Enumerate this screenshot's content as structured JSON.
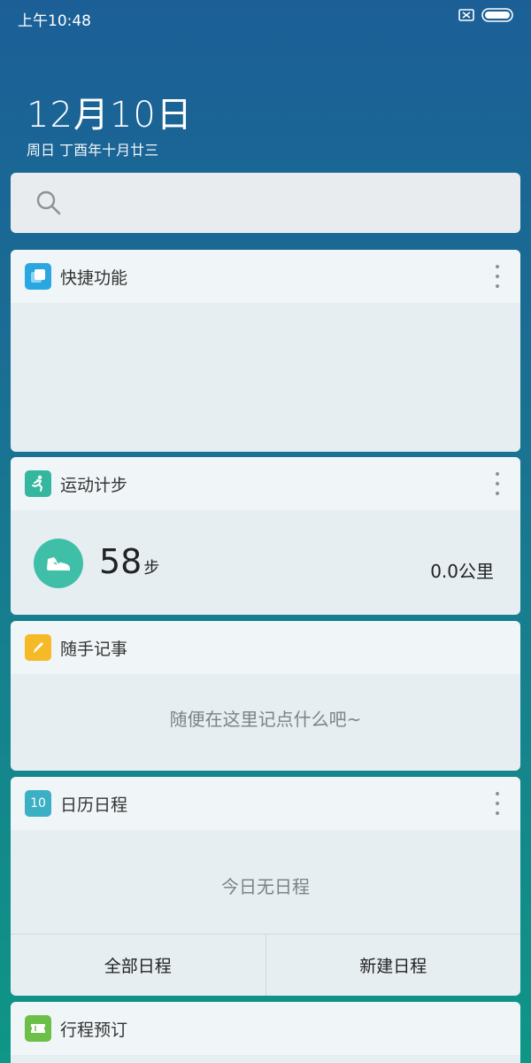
{
  "status_bar": {
    "time": "上午10:48",
    "icons": [
      "no-sim-icon",
      "battery-icon"
    ]
  },
  "header": {
    "date": "12月10日",
    "subtitle": "周日 丁酉年十月廿三"
  },
  "search": {
    "placeholder": ""
  },
  "cards": {
    "quick_functions": {
      "title": "快捷功能",
      "icon": "quick-functions-icon",
      "icon_color": "#2aa7e0"
    },
    "step_counter": {
      "title": "运动计步",
      "icon": "runner-icon",
      "icon_color": "#35b79f",
      "steps": "58",
      "steps_unit": "步",
      "distance": "0.0公里"
    },
    "notes": {
      "title": "随手记事",
      "icon": "pencil-icon",
      "icon_color": "#f6b928",
      "placeholder": "随便在这里记点什么吧~"
    },
    "calendar": {
      "title": "日历日程",
      "icon": "calendar-icon",
      "icon_text": "10",
      "icon_color": "#3bb0c4",
      "empty_text": "今日无日程",
      "all_label": "全部日程",
      "new_label": "新建日程"
    },
    "trip_booking": {
      "title": "行程预订",
      "icon": "ticket-icon",
      "icon_color": "#6cc04a"
    }
  }
}
